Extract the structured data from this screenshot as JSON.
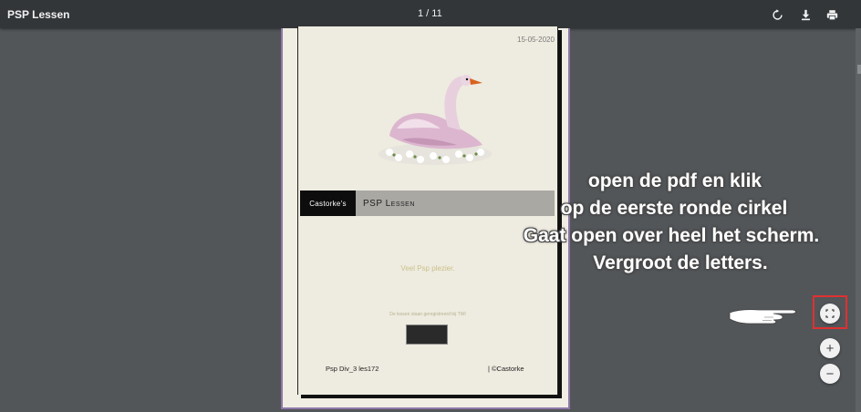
{
  "toolbar": {
    "title": "PSP Lessen",
    "page_indicator": "1 / 11",
    "buttons": [
      {
        "name": "rotate-icon"
      },
      {
        "name": "download-icon"
      },
      {
        "name": "print-icon"
      }
    ]
  },
  "document_page": {
    "date": "15-05-2020",
    "banner_left": "Castorke's",
    "banner_right": "PSP Lessen",
    "greeting": "Veel Psp plezier.",
    "note": "De lessen staan geregistreerd bij TWI",
    "footer_left": "Psp  Div_3  les172",
    "footer_right": "| ©Castorke"
  },
  "instructions": {
    "line1": "open de pdf en klik",
    "line2": "op de eerste ronde cirkel",
    "line3": "Gaat open over heel het scherm.",
    "line4": "Vergroot de letters."
  },
  "zoom_controls": {
    "fit_icon": "fit-to-page-icon",
    "zoom_in_icon": "zoom-in-icon",
    "zoom_in_glyph": "+",
    "zoom_out_icon": "zoom-out-icon",
    "zoom_out_glyph": "−"
  },
  "colors": {
    "toolbar_bg": "#323639",
    "viewer_bg": "#525659",
    "highlight": "#e03030",
    "page_border": "#8e78a8"
  }
}
